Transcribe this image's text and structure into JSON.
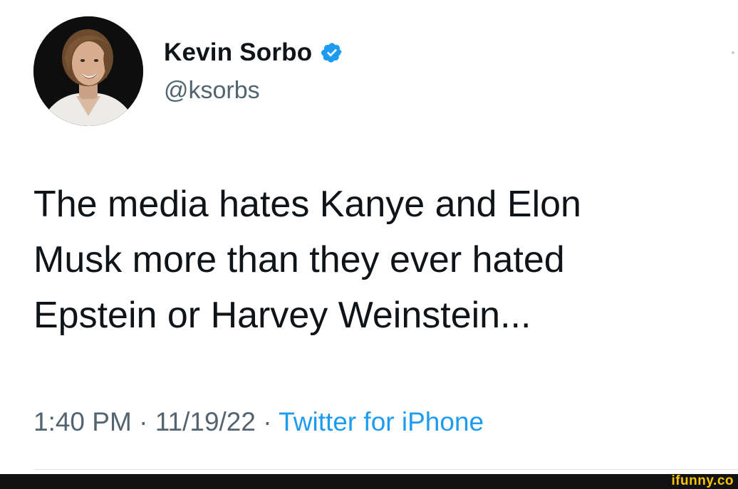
{
  "author": {
    "display_name": "Kevin Sorbo",
    "handle": "@ksorbs",
    "verified": true,
    "verified_color": "#1d9bf0"
  },
  "tweet": {
    "text": "The media hates Kanye and Elon\nMusk more than they ever hated\nEpstein or Harvey Weinstein..."
  },
  "meta": {
    "time": "1:40 PM",
    "separator_1": " · ",
    "date": "11/19/22",
    "separator_2": " · ",
    "source": "Twitter for iPhone",
    "source_color": "#1d9bf0"
  },
  "footer": {
    "watermark": "ifunny.co"
  },
  "icons": {
    "avatar": "profile-photo",
    "verified": "verified-badge-icon"
  }
}
